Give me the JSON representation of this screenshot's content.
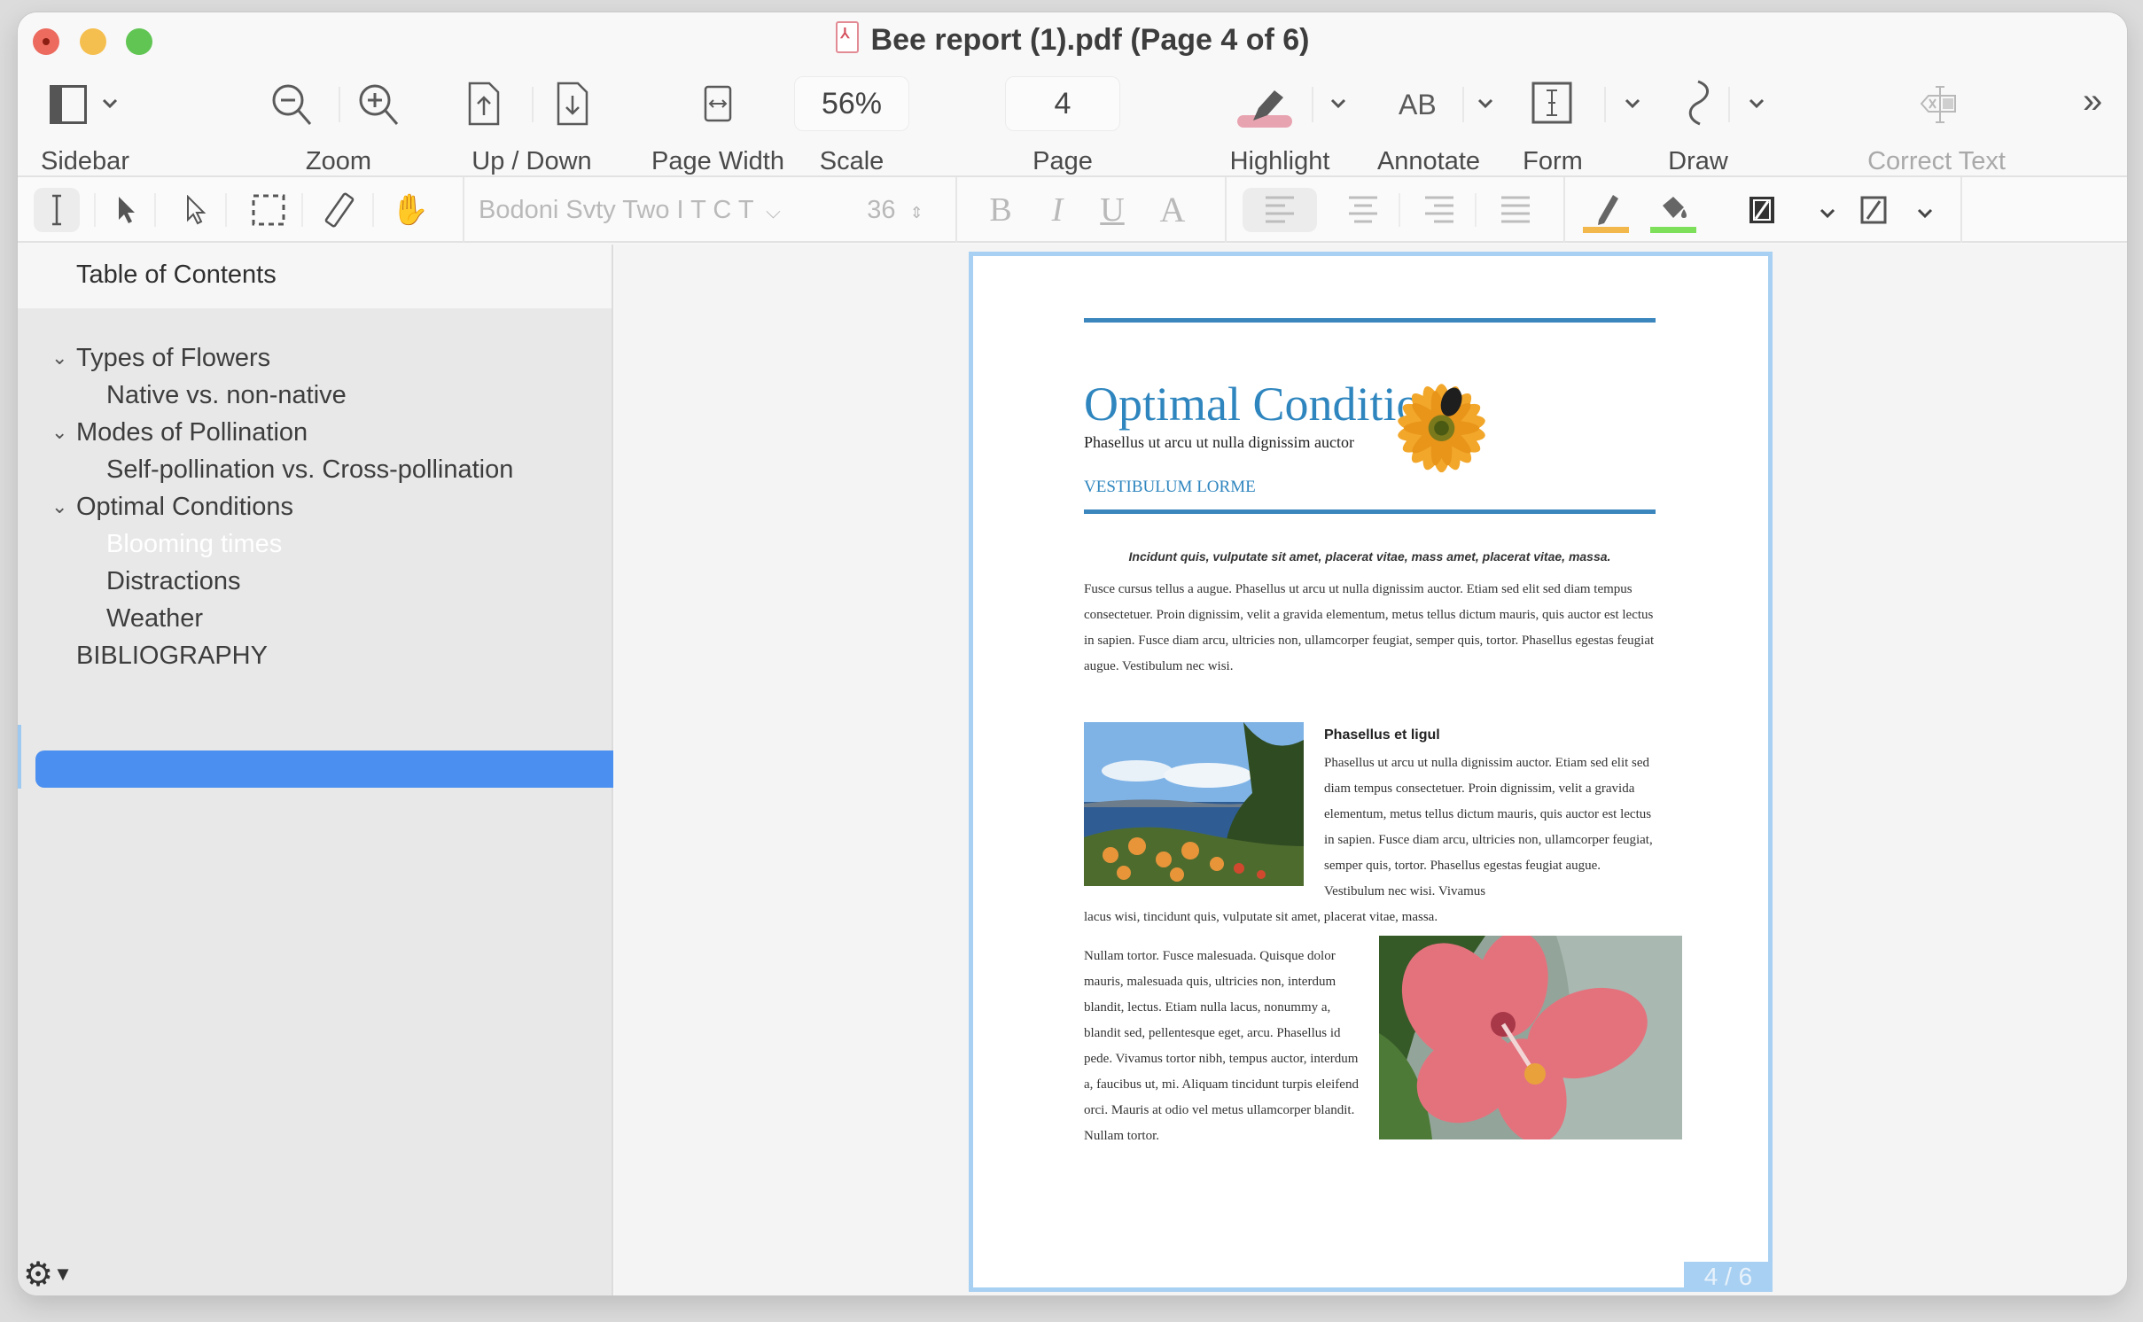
{
  "window": {
    "title": "Bee report (1).pdf (Page 4 of 6)",
    "file_icon": "pdf-file-icon"
  },
  "toolbar": {
    "sidebar_label": "Sidebar",
    "zoom_label": "Zoom",
    "updown_label": "Up / Down",
    "pagewidth_label": "Page Width",
    "scale_label": "Scale",
    "scale_value": "56%",
    "page_label": "Page",
    "page_value": "4",
    "highlight_label": "Highlight",
    "annotate_label": "Annotate",
    "annotate_icon_text": "AB",
    "form_label": "Form",
    "draw_label": "Draw",
    "correct_text_label": "Correct Text",
    "highlight_color": "#e8a3b0"
  },
  "formatbar": {
    "font_name": "Bodoni Svty Two I T C T",
    "font_size": "36",
    "bold": "B",
    "italic": "I",
    "underline": "U",
    "text_color": "A",
    "stroke_color": "#f2b84b",
    "fill_color": "#7ee05a"
  },
  "sidebar": {
    "header": "Table of Contents",
    "items": [
      {
        "label": "Types of Flowers",
        "level": 0,
        "expanded": true
      },
      {
        "label": "Native vs. non-native",
        "level": 1
      },
      {
        "label": "Modes of Pollination",
        "level": 0,
        "expanded": true
      },
      {
        "label": "Self-pollination vs. Cross-pollination",
        "level": 1
      },
      {
        "label": "Optimal Conditions",
        "level": 0,
        "expanded": true
      },
      {
        "label": "Blooming times",
        "level": 1,
        "selected": true
      },
      {
        "label": "Distractions",
        "level": 1
      },
      {
        "label": "Weather",
        "level": 1
      },
      {
        "label": "BIBLIOGRAPHY",
        "level": 0
      }
    ],
    "selection_color": "#4b8ff0"
  },
  "document": {
    "title": "Optimal Conditions",
    "subtitle": "Phasellus ut arcu ut nulla dignissim auctor",
    "kicker": "VESTIBULUM LORME",
    "quote": "Incidunt quis, vulputate sit amet, placerat vitae, mass amet, placerat vitae, massa.",
    "para1": "Fusce cursus tellus a augue. Phasellus ut arcu ut nulla dignissim auctor. Etiam sed elit sed diam tempus consectetuer. Proin dignissim, velit a gravida elementum, metus tellus dictum mauris, quis auctor est lectus in sapien. Fusce diam arcu, ultricies non, ullamcorper feugiat, semper quis, tortor. Phasellus egestas feugiat augue. Vestibulum nec wisi.",
    "section_heading": "Phasellus et ligul",
    "para2": "Phasellus ut arcu ut nulla dignissim auctor. Etiam sed elit sed diam tempus consectetuer. Proin dignissim, velit a gravida elementum, metus tellus dictum mauris, quis auctor est lectus in sapien. Fusce diam arcu, ultricies non, ullamcorper feugiat, semper quis, tortor. Phasellus egestas feugiat augue. Vestibulum nec wisi. Vivamus",
    "para2_tail": "lacus wisi, tincidunt quis, vulputate sit amet, placerat vitae, massa.",
    "para3": "Nullam tortor. Fusce malesuada. Quisque dolor mauris, malesuada quis, ultricies non, interdum blandit, lectus. Etiam nulla lacus, nonummy a, blandit sed, pellentesque eget, arcu. Phasellus id pede. Vivamus tortor nibh, tempus auctor, interdum a, faucibus ut, mi. Aliquam tincidunt turpis eleifend orci. Mauris at odio vel metus ullamcorper blandit. Nullam tortor.",
    "accent_color": "#2f86bf",
    "page_indicator": "4 / 6",
    "images": [
      "sunflower-with-bee",
      "coastal-landscape-with-flowers",
      "pink-hibiscus-flower"
    ]
  }
}
